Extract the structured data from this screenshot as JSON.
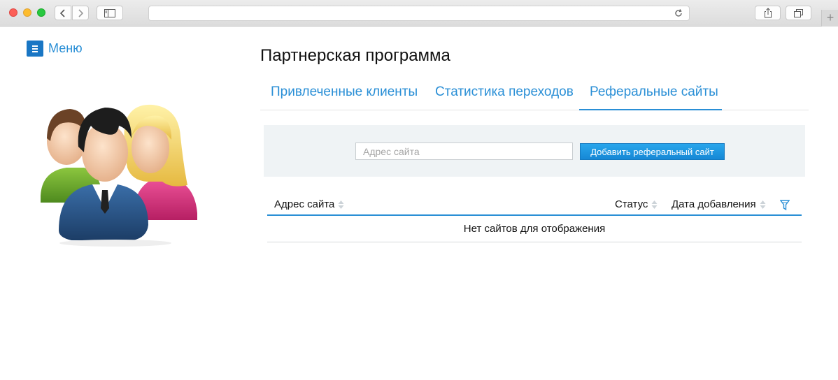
{
  "browser": {
    "url": "",
    "new_tab_label": "+"
  },
  "sidebar": {
    "menu_label": "Меню"
  },
  "page": {
    "title": "Партнерская программа"
  },
  "tabs": [
    {
      "label": "Привлеченные клиенты",
      "active": false
    },
    {
      "label": "Статистика переходов",
      "active": false
    },
    {
      "label": "Реферальные сайты",
      "active": true
    }
  ],
  "filter": {
    "site_placeholder": "Адрес сайта",
    "site_value": "",
    "add_button_label": "Добавить реферальный сайт"
  },
  "grid": {
    "columns": [
      {
        "label": "Адрес сайта"
      },
      {
        "label": "Статус"
      },
      {
        "label": "Дата добавления"
      }
    ],
    "empty_text": "Нет сайтов для отображения"
  },
  "colors": {
    "accent": "#2a8fd6",
    "button": "#1688d6",
    "panel_bg": "#eff3f5"
  }
}
